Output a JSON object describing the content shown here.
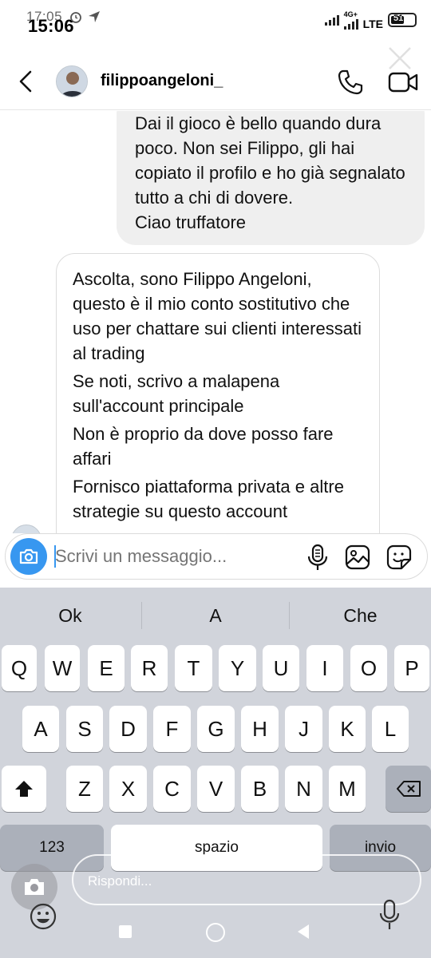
{
  "status_bar": {
    "time_behind": "17:05",
    "time": "15:06",
    "network_label": "4G+",
    "lte_label": "LTE",
    "battery_level": "51"
  },
  "header": {
    "username": "filippoangeloni_"
  },
  "messages": {
    "outgoing": [
      "Dai il gioco è bello quando dura poco. Non sei Filippo, gli hai copiato il profilo e ho già segnalato tutto a chi di dovere.",
      "Ciao truffatore"
    ],
    "incoming": [
      "Ascolta, sono Filippo Angeloni, questo è il mio conto sostitutivo che uso per chattare sui clienti interessati al trading",
      "Se noti, scrivo a malapena sull'account principale",
      "Non è proprio da dove posso fare affari",
      "Fornisco piattaforma privata e altre strategie su questo account"
    ]
  },
  "composer": {
    "placeholder": "Scrivi un messaggio..."
  },
  "keyboard": {
    "suggestions": [
      "Ok",
      "A",
      "Che"
    ],
    "row1": [
      "Q",
      "W",
      "E",
      "R",
      "T",
      "Y",
      "U",
      "I",
      "O",
      "P"
    ],
    "row2": [
      "A",
      "S",
      "D",
      "F",
      "G",
      "H",
      "J",
      "K",
      "L"
    ],
    "row3": [
      "Z",
      "X",
      "C",
      "V",
      "B",
      "N",
      "M"
    ],
    "numbers_label": "123",
    "space_label": "spazio",
    "return_label": "invio"
  },
  "reply_overlay": {
    "placeholder": "Rispondi..."
  },
  "colors": {
    "accent": "#3797f0",
    "keyboard_bg": "#d1d4db",
    "outgoing_bubble": "#efefef"
  }
}
